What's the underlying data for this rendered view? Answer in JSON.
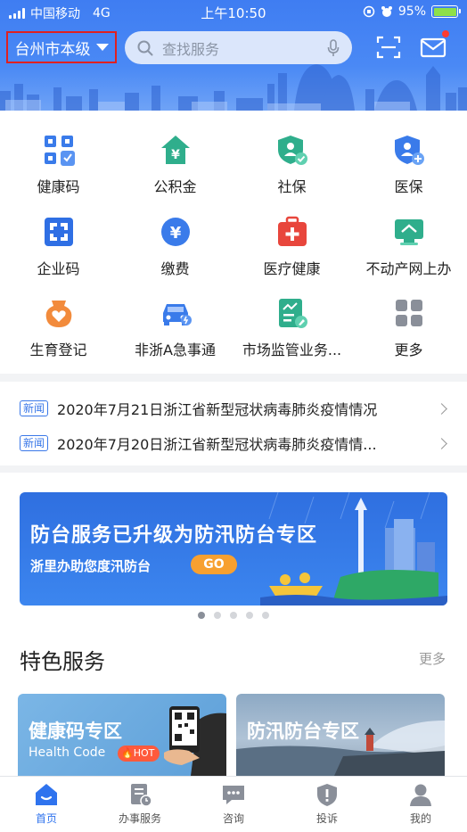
{
  "status_bar": {
    "carrier": "中国移动",
    "network": "4G",
    "time": "上午10:50",
    "battery": "95%"
  },
  "header": {
    "city": "台州市本级",
    "search_placeholder": "查找服务"
  },
  "services": [
    {
      "label": "健康码",
      "icon": "health-code-icon"
    },
    {
      "label": "公积金",
      "icon": "housing-fund-icon"
    },
    {
      "label": "社保",
      "icon": "social-security-icon"
    },
    {
      "label": "医保",
      "icon": "medical-insurance-icon"
    },
    {
      "label": "企业码",
      "icon": "enterprise-code-icon"
    },
    {
      "label": "缴费",
      "icon": "payment-icon"
    },
    {
      "label": "医疗健康",
      "icon": "medical-kit-icon"
    },
    {
      "label": "不动产网上办",
      "icon": "real-estate-icon"
    },
    {
      "label": "生育登记",
      "icon": "birth-registration-icon"
    },
    {
      "label": "非浙A急事通",
      "icon": "car-icon"
    },
    {
      "label": "市场监管业务...",
      "icon": "market-supervision-icon"
    },
    {
      "label": "更多",
      "icon": "more-grid-icon"
    }
  ],
  "news": [
    {
      "tag": "新闻",
      "text": "2020年7月21日浙江省新型冠状病毒肺炎疫情情况"
    },
    {
      "tag": "新闻",
      "text": "2020年7月20日浙江省新型冠状病毒肺炎疫情情..."
    }
  ],
  "banner": {
    "title": "防台服务已升级为防汛防台专区",
    "subtitle": "浙里办助您度汛防台",
    "button": "GO",
    "pages": 5,
    "active_page": 1
  },
  "featured": {
    "title": "特色服务",
    "more": "更多",
    "cards": [
      {
        "title": "健康码专区",
        "subtitle": "Health Code",
        "badge": "HOT"
      },
      {
        "title": "防汛防台专区"
      }
    ]
  },
  "tabs": [
    {
      "label": "首页",
      "icon": "home-icon",
      "active": true
    },
    {
      "label": "办事服务",
      "icon": "service-doc-icon",
      "active": false
    },
    {
      "label": "咨询",
      "icon": "chat-icon",
      "active": false
    },
    {
      "label": "投诉",
      "icon": "complaint-shield-icon",
      "active": false
    },
    {
      "label": "我的",
      "icon": "user-icon",
      "active": false
    }
  ],
  "colors": {
    "brand_blue": "#3f7df2",
    "tab_active": "#2f73ee",
    "highlight_border": "#e02020"
  }
}
